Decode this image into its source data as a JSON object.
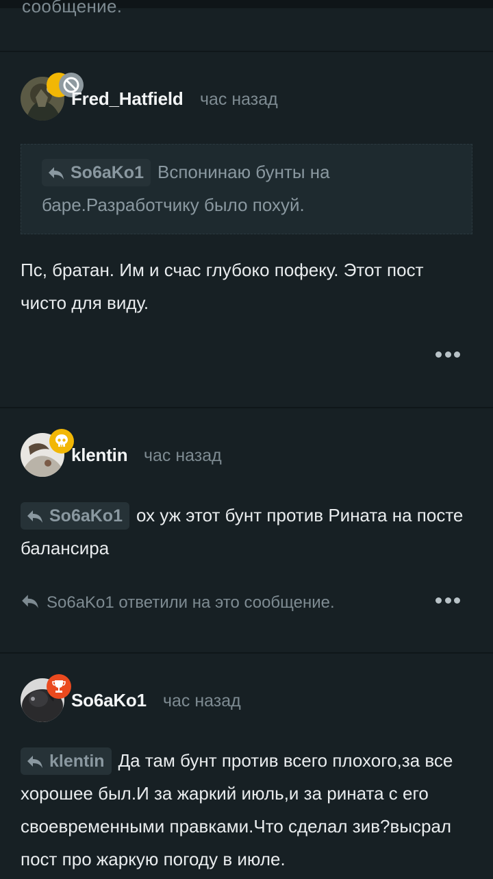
{
  "top_fragment": "сообщение.",
  "comments": [
    {
      "author": "Fred_Hatfield",
      "time": "час назад",
      "badge": "ban-icon",
      "quote": {
        "author": "So6aKo1",
        "text": "Вспонинаю бунты на баре.Разработчику было похуй."
      },
      "body": "Пс, братан. Им и счас глубоко пофеку. Этот пост чисто для виду."
    },
    {
      "author": "klentin",
      "time": "час назад",
      "badge": "skull-icon",
      "reply_to": "So6aKo1",
      "body": "ох уж этот бунт против Рината на посте балансира",
      "replies_note": "So6aKo1 ответили на это сообщение."
    },
    {
      "author": "So6aKo1",
      "time": "час назад",
      "badge": "trophy-icon",
      "reply_to": "klentin",
      "body": "Да там бунт против всего плохого,за все хорошее был.И за жаркий июль,и за рината с его своевременными правками.Что сделал зив?высрал пост про жаркую погоду в июле."
    }
  ],
  "colors": {
    "background": "#172024",
    "quote_bg": "#1e2a2f",
    "chip_bg": "#263237",
    "muted_text": "#7e8b92",
    "badge_ban": "#8f9aa0",
    "badge_gold": "#f2b705",
    "badge_orange": "#ea4a1f"
  }
}
